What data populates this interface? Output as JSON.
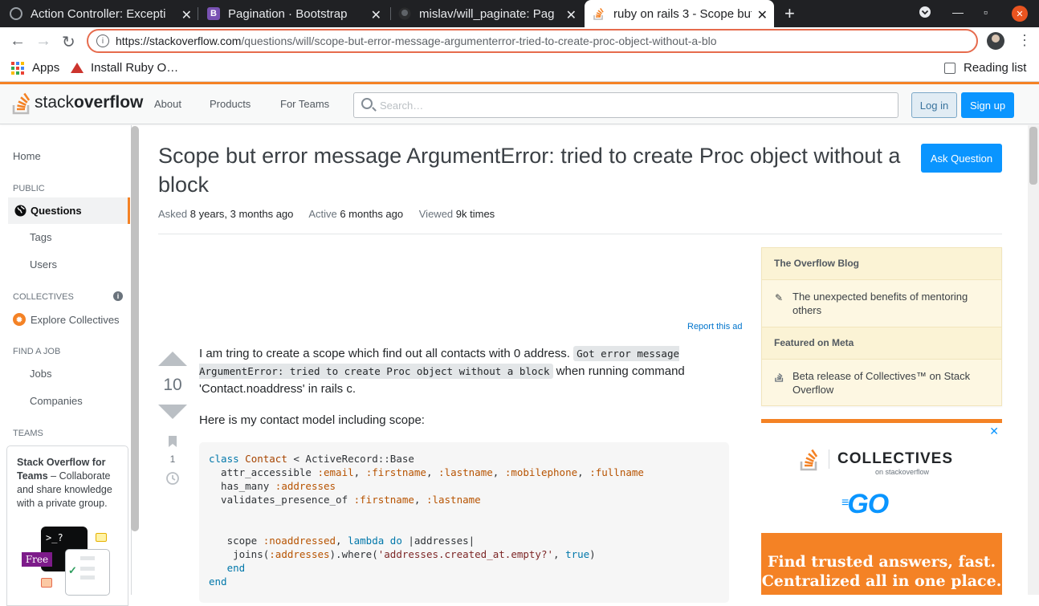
{
  "browser": {
    "tabs": [
      {
        "title": "Action Controller: Excepti",
        "icon": "rails-icon"
      },
      {
        "title": "Pagination · Bootstrap",
        "icon": "bootstrap-icon"
      },
      {
        "title": "mislav/will_paginate: Pag",
        "icon": "github-icon"
      },
      {
        "title": "ruby on rails 3 - Scope but",
        "icon": "stackoverflow-icon"
      }
    ],
    "url_host": "https://stackoverflow.com",
    "url_path": "/questions/will/scope-but-error-message-argumenterror-tried-to-create-proc-object-without-a-blo",
    "bookmarks": {
      "apps": "Apps",
      "ruby": "Install Ruby O…",
      "reading_list": "Reading list"
    }
  },
  "header": {
    "logo_light": "stack",
    "logo_bold": "overflow",
    "nav": [
      "About",
      "Products",
      "For Teams"
    ],
    "search_placeholder": "Search…",
    "login": "Log in",
    "signup": "Sign up"
  },
  "sidebar": {
    "home": "Home",
    "public": "PUBLIC",
    "questions": "Questions",
    "tags": "Tags",
    "users": "Users",
    "collectives": "COLLECTIVES",
    "explore": "Explore Collectives",
    "find_job": "FIND A JOB",
    "jobs": "Jobs",
    "companies": "Companies",
    "teams": "TEAMS",
    "teams_title": "Stack Overflow for Teams",
    "teams_text": " – Collaborate and share knowledge with a private group.",
    "free": "Free"
  },
  "question": {
    "title": "Scope but error message ArgumentError: tried to create Proc object without a block",
    "ask": "Ask Question",
    "asked_label": "Asked",
    "asked": "8 years, 3 months ago",
    "active_label": "Active",
    "active": "6 months ago",
    "viewed_label": "Viewed",
    "viewed": "9k times",
    "report_ad": "Report this ad",
    "votes": "10",
    "bookmarks": "1",
    "body_p1_a": "I am tring to create a scope which find out all contacts with 0 address. ",
    "body_p1_code": "Got error message ArgumentError: tried to create Proc object without a block",
    "body_p1_b": " when running command 'Contact.noaddress' in rails c.",
    "body_p2": "Here is my contact model including scope:"
  },
  "code": {
    "l1_kw": "class",
    "l1_cls": "Contact",
    "l1_rest": " < ActiveRecord::Base",
    "l2_a": "  attr_accessible ",
    "l2_s1": ":email",
    "l2_s2": ":firstname",
    "l2_s3": ":lastname",
    "l2_s4": ":mobilephone",
    "l2_s5": ":fullname",
    "l3_a": "  has_many ",
    "l3_s": ":addresses",
    "l4_a": "  validates_presence_of ",
    "l4_s1": ":firstname",
    "l4_s2": ":lastname",
    "l5_a": "   scope ",
    "l5_s": ":noaddressed",
    "l5_kw1": "lambda",
    "l5_kw2": "do",
    "l5_rest": " |addresses|",
    "l6_a": "    joins(",
    "l6_s": ":addresses",
    "l6_b": ").where(",
    "l6_str": "'addresses.created_at.empty?'",
    "l6_kw": "true",
    "l6_c": ")",
    "l7": "   end",
    "l8": "end"
  },
  "blog": {
    "h1": "The Overflow Blog",
    "i1": "The unexpected benefits of mentoring others",
    "h2": "Featured on Meta",
    "i2": "Beta release of Collectives™ on Stack Overflow"
  },
  "ad": {
    "collectives": "COLLECTIVES",
    "on": "on stackoverflow",
    "go": "GO",
    "tagline1": "Find trusted answers, fast.",
    "tagline2": "Centralized all in one place."
  },
  "colors": {
    "accent": "#f48225",
    "blue": "#0a95ff"
  }
}
